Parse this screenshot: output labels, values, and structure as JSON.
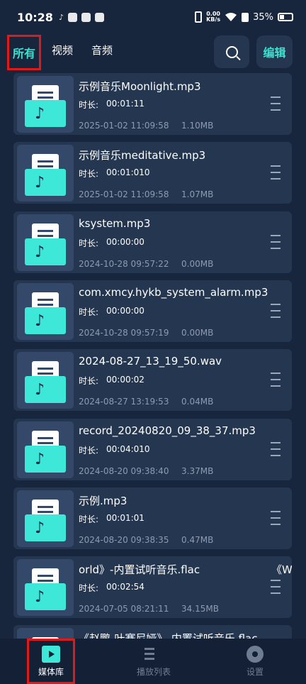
{
  "status": {
    "time": "10:28",
    "network_speed": "0.00\nKB/s",
    "battery": "35%"
  },
  "header": {
    "tabs": [
      "所有",
      "视频",
      "音频"
    ],
    "edit_label": "编辑"
  },
  "files": [
    {
      "name": "示例音乐Moonlight.mp3",
      "duration_label": "时长:",
      "duration": "00:01:11",
      "date": "2025-01-02 11:09:58",
      "size": "1.10MB"
    },
    {
      "name": "示例音乐meditative.mp3",
      "duration_label": "时长:",
      "duration": "00:01:010",
      "date": "2025-01-02 11:09:58",
      "size": "1.07MB"
    },
    {
      "name": "ksystem.mp3",
      "duration_label": "时长:",
      "duration": "00:00:00",
      "date": "2024-10-28 09:57:22",
      "size": "0.00MB"
    },
    {
      "name": "com.xmcy.hykb_system_alarm.mp3",
      "duration_label": "时长:",
      "duration": "00:00:00",
      "date": "2024-10-28 09:57:19",
      "size": "0.00MB"
    },
    {
      "name": "2024-08-27_13_19_50.wav",
      "duration_label": "时长:",
      "duration": "00:00:02",
      "date": "2024-08-27 13:19:53",
      "size": "0.04MB"
    },
    {
      "name": "record_20240820_09_38_37.mp3",
      "duration_label": "时长:",
      "duration": "00:04:010",
      "date": "2024-08-20 09:38:40",
      "size": "3.37MB"
    },
    {
      "name": "示例.mp3",
      "duration_label": "时长:",
      "duration": "00:01:01",
      "date": "2024-08-20 09:38:35",
      "size": "0.47MB"
    },
    {
      "name": "orld》-内置试听音乐.flac",
      "name_extra": "《W",
      "duration_label": "时长:",
      "duration": "00:02:54",
      "date": "2024-07-05 08:21:11",
      "size": "34.15MB"
    },
    {
      "name": "《赵鹏-叶赛尼娅》-内置试听音乐.flac",
      "duration_label": "",
      "duration": "",
      "date": "",
      "size": ""
    }
  ],
  "bottom_nav": {
    "media_library": "媒体库",
    "playlist": "播放列表",
    "settings": "设置"
  },
  "colors": {
    "background": "#17253d",
    "card": "#253650",
    "accent": "#3de0d0",
    "highlight_border": "#e11919"
  },
  "icons": [
    "search-icon",
    "music-file-icon",
    "more-menu-icon",
    "media-library-icon",
    "playlist-icon",
    "settings-gear-icon"
  ]
}
